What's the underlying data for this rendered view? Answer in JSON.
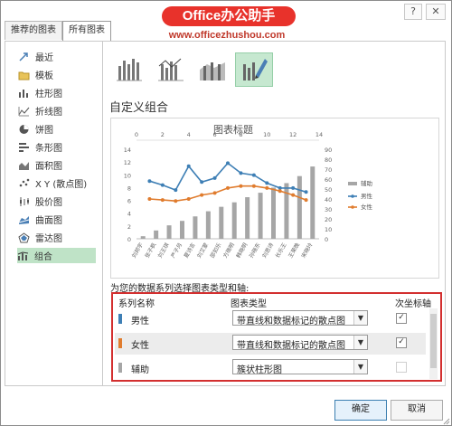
{
  "tabs": [
    {
      "label": "推荐的图表"
    },
    {
      "label": "所有图表"
    }
  ],
  "window_controls": {
    "help": "?",
    "close": "✕"
  },
  "watermark": {
    "title": "Office办公助手",
    "url": "www.officezhushou.com"
  },
  "sidebar": {
    "items": [
      {
        "label": "最近",
        "icon": "recent-icon"
      },
      {
        "label": "模板",
        "icon": "template-folder-icon"
      },
      {
        "label": "柱形图",
        "icon": "column-chart-icon"
      },
      {
        "label": "折线图",
        "icon": "line-chart-icon"
      },
      {
        "label": "饼图",
        "icon": "pie-chart-icon"
      },
      {
        "label": "条形图",
        "icon": "bar-chart-icon"
      },
      {
        "label": "面积图",
        "icon": "area-chart-icon"
      },
      {
        "label": "X Y (散点图)",
        "icon": "scatter-chart-icon"
      },
      {
        "label": "股价图",
        "icon": "stock-chart-icon"
      },
      {
        "label": "曲面图",
        "icon": "surface-chart-icon"
      },
      {
        "label": "雷达图",
        "icon": "radar-chart-icon"
      },
      {
        "label": "组合",
        "icon": "combo-chart-icon"
      }
    ],
    "selected": "组合"
  },
  "subtypes": [
    "clustered-column-line-icon",
    "clustered-column-line-secondary-icon",
    "stacked-area-column-icon",
    "custom-combo-icon"
  ],
  "section_title": "自定义组合",
  "chart_data": {
    "type": "combo",
    "title": "图表标题",
    "categories": [
      "刘邦宇",
      "张子枫",
      "刘王琪",
      "严子月",
      "夏诗言",
      "刘艾蒙",
      "邵如乐",
      "方晓明",
      "韩晓明",
      "孙晓东",
      "刘思诗",
      "长乐王",
      "王荣晚",
      "宋晓玲"
    ],
    "primary_x_ticks": [
      "0",
      "2",
      "4",
      "6",
      "8",
      "10",
      "12",
      "14"
    ],
    "left_y_ticks": [
      "0",
      "2",
      "4",
      "6",
      "8",
      "10",
      "12",
      "14"
    ],
    "right_y_ticks": [
      "0",
      "10",
      "20",
      "30",
      "40",
      "50",
      "60",
      "70",
      "80",
      "90"
    ],
    "ylim_left": [
      0,
      14
    ],
    "ylim_right": [
      0,
      90
    ],
    "series": [
      {
        "name": "辅助",
        "type": "column",
        "color": "#a6a6a6",
        "values": [
          0.4,
          1.3,
          2.1,
          2.8,
          3.5,
          4.3,
          5.0,
          5.7,
          6.5,
          7.2,
          8.0,
          8.7,
          9.8,
          11.3
        ]
      },
      {
        "name": "男性",
        "type": "line",
        "color": "#3e7fb5",
        "values": [
          58,
          54,
          49,
          73,
          57,
          61,
          76,
          66,
          64,
          56,
          51,
          51,
          47
        ]
      },
      {
        "name": "女性",
        "type": "line",
        "color": "#e07c2e",
        "values": [
          40,
          39,
          38,
          40,
          44,
          46,
          51,
          53,
          53,
          51,
          48,
          44,
          39
        ]
      }
    ],
    "legend_position": "right",
    "gridlines": false
  },
  "caption": "为您的数据系列选择图表类型和轴:",
  "table": {
    "headers": {
      "name": "系列名称",
      "type": "图表类型",
      "axis": "次坐标轴"
    },
    "rows": [
      {
        "name": "男性",
        "color": "#3e7fb5",
        "type": "带直线和数据标记的散点图",
        "secondary": true
      },
      {
        "name": "女性",
        "color": "#e07c2e",
        "type": "带直线和数据标记的散点图",
        "secondary": true
      },
      {
        "name": "辅助",
        "color": "#a6a6a6",
        "type": "簇状柱形图",
        "secondary": false
      }
    ]
  },
  "buttons": {
    "ok": "确定",
    "cancel": "取消"
  }
}
